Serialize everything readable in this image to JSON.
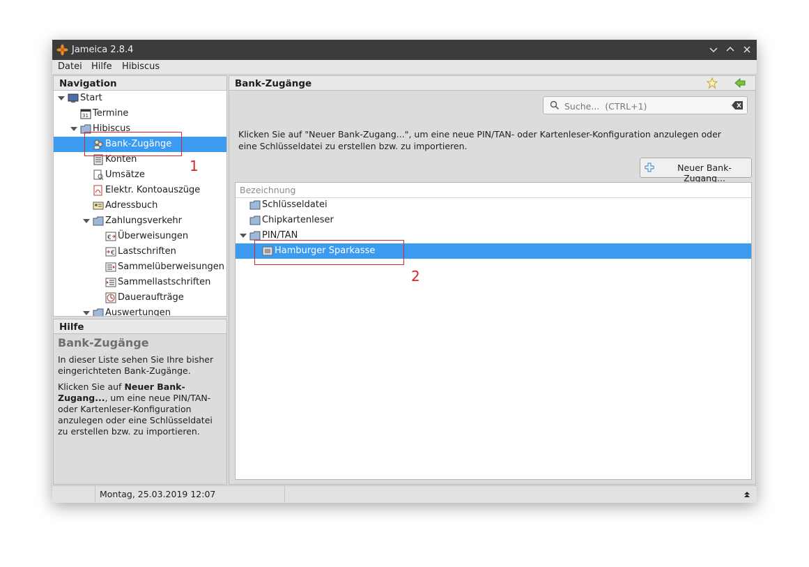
{
  "window": {
    "title": "Jameica 2.8.4"
  },
  "menu": [
    "Datei",
    "Hilfe",
    "Hibiscus"
  ],
  "navigation": {
    "title": "Navigation",
    "items": [
      {
        "label": "Start"
      },
      {
        "label": "Termine"
      },
      {
        "label": "Hibiscus"
      },
      {
        "label": "Bank-Zugänge"
      },
      {
        "label": "Konten"
      },
      {
        "label": "Umsätze"
      },
      {
        "label": "Elektr. Kontoauszüge"
      },
      {
        "label": "Adressbuch"
      },
      {
        "label": "Zahlungsverkehr"
      },
      {
        "label": "Überweisungen"
      },
      {
        "label": "Lastschriften"
      },
      {
        "label": "Sammelüberweisungen"
      },
      {
        "label": "Sammellastschriften"
      },
      {
        "label": "Daueraufträge"
      },
      {
        "label": "Auswertungen"
      }
    ]
  },
  "help": {
    "title": "Hilfe",
    "heading": "Bank-Zugänge",
    "p1": "In dieser Liste sehen Sie Ihre bisher eingerichteten Bank-Zugänge.",
    "p2_pre": "Klicken Sie auf ",
    "p2_bold": "Neuer Bank-Zugang...",
    "p2_post": ", um eine neue PIN/TAN- oder Kartenleser-Konfiguration anzulegen oder eine Schlüsseldatei zu erstellen bzw. zu importieren."
  },
  "main": {
    "title": "Bank-Zugänge",
    "search_placeholder": "Suche...  (CTRL+1)",
    "info": "Klicken Sie auf \"Neuer Bank-Zugang...\", um eine neue PIN/TAN- oder Kartenleser-Konfiguration anzulegen oder eine Schlüsseldatei zu erstellen bzw. zu importieren.",
    "new_button": "Neuer Bank-Zugang...",
    "table_header": "Bezeichnung",
    "rows": [
      {
        "label": "Schlüsseldatei"
      },
      {
        "label": "Chipkartenleser"
      },
      {
        "label": "PIN/TAN"
      },
      {
        "label": "Hamburger Sparkasse"
      }
    ]
  },
  "statusbar": {
    "datetime": "Montag, 25.03.2019 12:07"
  },
  "annotations": [
    "1",
    "2"
  ],
  "colors": {
    "selection": "#3a9bf0",
    "annotation": "#d9232e",
    "titlebar": "#3c3c3c"
  }
}
